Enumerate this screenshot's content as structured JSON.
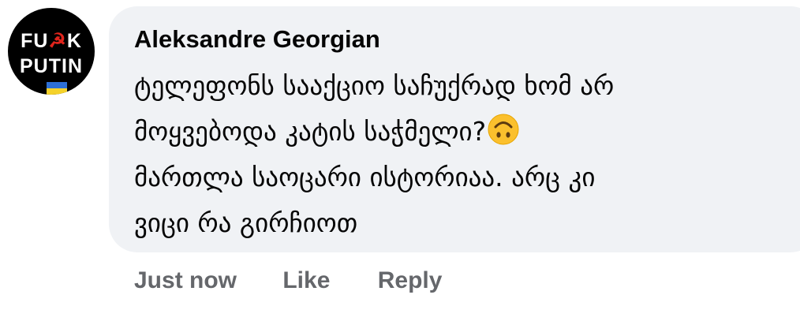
{
  "avatar": {
    "text_line1_a": "FU",
    "text_line1_b": "K",
    "text_line2": "PUTIN",
    "icon": "hammer-and-sickle-icon",
    "flag": "ukraine-flag-icon",
    "accent_red": "#e0241c",
    "flag_blue": "#2d6fd6",
    "flag_yellow": "#f5d22a"
  },
  "comment": {
    "author": "Aleksandre Georgian",
    "lines": [
      "ტელეფონს სააქციო საჩუქრად ხომ არ",
      "მოყვებოდა კატის საჭმელი?",
      "მართლა საოცარი ისტორიაა. არც კი",
      "ვიცი რა გირჩიოთ"
    ],
    "emoji": "upside-down-face-icon",
    "bubble_color": "#f0f2f5"
  },
  "actions": {
    "timestamp": "Just now",
    "like_label": "Like",
    "reply_label": "Reply",
    "color": "#65676b"
  }
}
